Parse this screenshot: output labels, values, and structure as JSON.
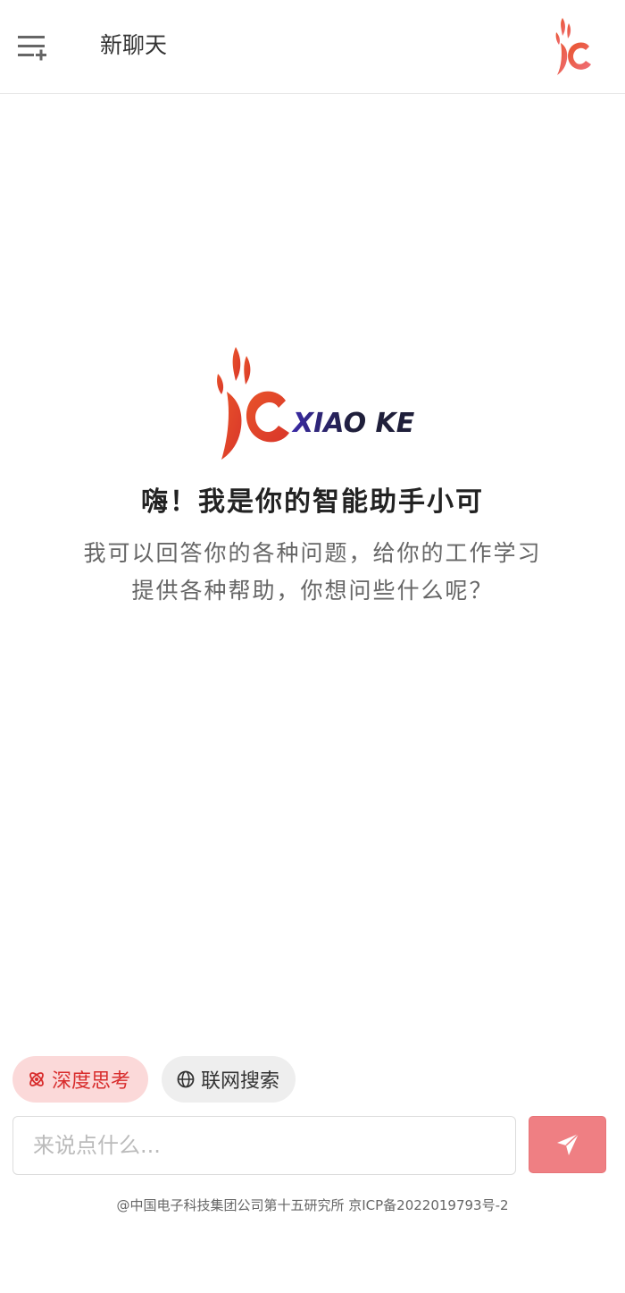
{
  "header": {
    "title": "新聊天",
    "menu_icon": "menu-add-icon",
    "logo_icon": "xiaoke-logo-icon"
  },
  "hero": {
    "brand_text": "XIAO KE",
    "title": "嗨！我是你的智能助手小可",
    "description": "我可以回答你的各种问题，给你的工作学习提供各种帮助，你想问些什么呢？"
  },
  "options": {
    "deep_thinking": {
      "label": "深度思考",
      "icon": "atom-icon",
      "active": true
    },
    "web_search": {
      "label": "联网搜索",
      "icon": "globe-icon",
      "active": false
    }
  },
  "composer": {
    "placeholder": "来说点什么...",
    "value": "",
    "send_icon": "send-icon"
  },
  "footer": {
    "text": "@中国电子科技集团公司第十五研究所 京ICP备2022019793号-2"
  },
  "colors": {
    "accent": "#ef7f83",
    "chip_active_bg": "#fbd9d9",
    "chip_active_text": "#d82c2c",
    "logo_orange": "#e8532a"
  }
}
